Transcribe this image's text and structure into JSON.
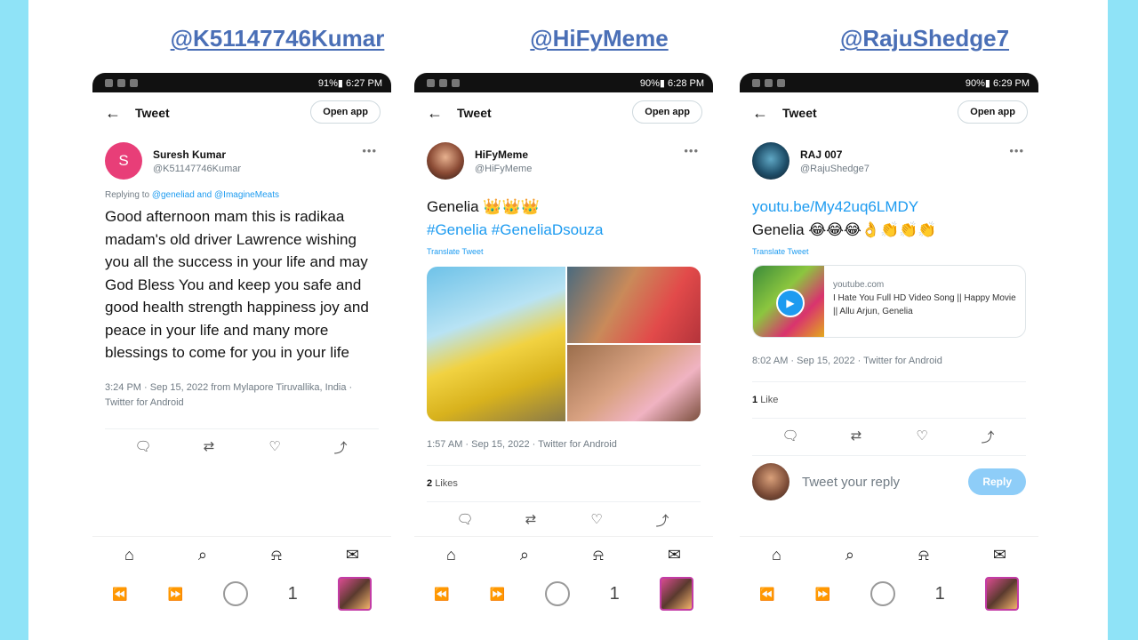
{
  "handles": [
    "@K51147746Kumar",
    "@HiFyMeme",
    "@RajuShedge7"
  ],
  "phones": [
    {
      "status": "91%▮ 6:27 PM",
      "header": {
        "back": "←",
        "title": "Tweet",
        "open_app": "Open app"
      },
      "author": {
        "initial": "S",
        "name": "Suresh Kumar",
        "handle": "@K51147746Kumar",
        "avatar_color": "#e83e78"
      },
      "replying_prefix": "Replying to ",
      "replying_mentions": "@geneliad and @ImagineMeats",
      "text": "Good afternoon mam this is radikaa madam's old driver Lawrence wishing you all the success in your life and may God Bless You and keep you safe and good health strength happiness joy and peace in your life and many more blessings to come for you in your life",
      "meta": "3:24 PM · Sep 15, 2022 from Mylapore Tiruvallika, India · Twitter for Android"
    },
    {
      "status": "90%▮ 6:28 PM",
      "header": {
        "back": "←",
        "title": "Tweet",
        "open_app": "Open app"
      },
      "author": {
        "name": "HiFyMeme",
        "handle": "@HiFyMeme"
      },
      "text_line1": "Genelia 👑👑👑",
      "hashtags": "#Genelia #GeneliaDsouza",
      "translate": "Translate Tweet",
      "meta": "1:57 AM · Sep 15, 2022 · Twitter for Android",
      "likes_count": "2",
      "likes_label": "Likes"
    },
    {
      "status": "90%▮ 6:29 PM",
      "header": {
        "back": "←",
        "title": "Tweet",
        "open_app": "Open app"
      },
      "author": {
        "name": "RAJ 007",
        "handle": "@RajuShedge7"
      },
      "link": "youtu.be/My42uq6LMDY",
      "text_line2": "Genelia 😂😂😂👌👏👏👏",
      "translate": "Translate Tweet",
      "card": {
        "domain": "youtube.com",
        "title": "I Hate You Full HD Video Song || Happy Movie || Allu Arjun, Genelia"
      },
      "meta": "8:02 AM · Sep 15, 2022 · Twitter for Android",
      "likes_count": "1",
      "likes_label": "Like",
      "reply_placeholder": "Tweet your reply",
      "reply_button": "Reply"
    }
  ],
  "nav_icons": [
    "home-icon",
    "search-icon",
    "bell-icon",
    "mail-icon"
  ],
  "system_nav": {
    "page_number": "1"
  }
}
